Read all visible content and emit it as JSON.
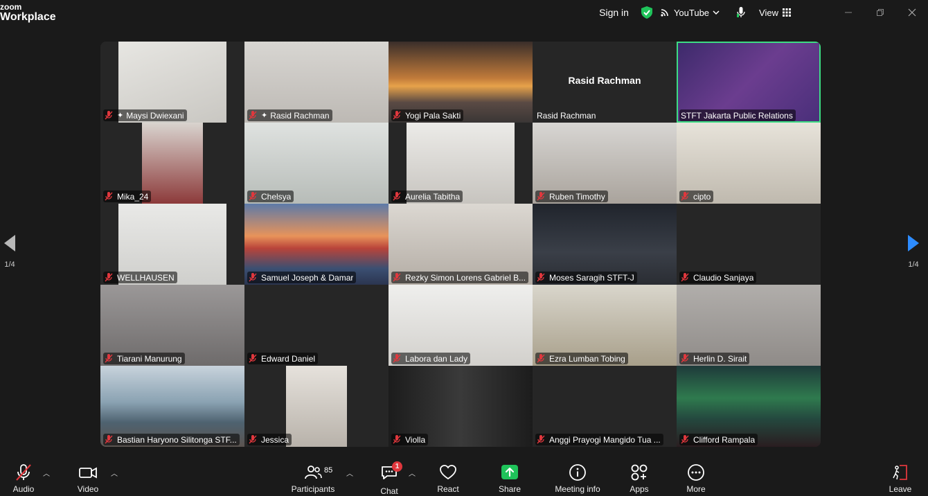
{
  "app": {
    "logo_line1": "zoom",
    "logo_line2": "Workplace"
  },
  "topbar": {
    "sign_in": "Sign in",
    "stream_label": "YouTube",
    "view_label": "View"
  },
  "pager": {
    "left": "1/4",
    "right": "1/4"
  },
  "colors": {
    "active_border": "#3ddc84",
    "mic_muted": "#e0373d",
    "share_green": "#1fc35a",
    "badge_red": "#e0373d"
  },
  "participants": [
    {
      "name": "Maysi Dwiexani",
      "pinned": true
    },
    {
      "name": "Rasid Rachman",
      "pinned": true
    },
    {
      "name": "Yogi Pala Sakti"
    },
    {
      "name": "Rasid Rachman",
      "video_off": true,
      "display_name": "Rasid Rachman"
    },
    {
      "name": "STFT Jakarta Public Relations",
      "active": true
    },
    {
      "name": "Mika_24"
    },
    {
      "name": "Chelsya"
    },
    {
      "name": "Aurelia Tabitha"
    },
    {
      "name": "Ruben Timothy"
    },
    {
      "name": "cipto"
    },
    {
      "name": "WELLHAUSEN"
    },
    {
      "name": "Samuel Joseph & Damar"
    },
    {
      "name": "Rezky Simon Lorens Gabriel B..."
    },
    {
      "name": "Moses Saragih STFT-J"
    },
    {
      "name": "Claudio Sanjaya"
    },
    {
      "name": "Tiarani Manurung"
    },
    {
      "name": "Edward Daniel"
    },
    {
      "name": "Labora dan Lady"
    },
    {
      "name": "Ezra Lumban Tobing"
    },
    {
      "name": "Herlin D. Sirait"
    },
    {
      "name": "Bastian Haryono Silitonga STF..."
    },
    {
      "name": "Jessica"
    },
    {
      "name": "Violla"
    },
    {
      "name": "Anggi Prayogi Mangido Tua ..."
    },
    {
      "name": "Clifford Rampala"
    }
  ],
  "toolbar": {
    "audio": "Audio",
    "video": "Video",
    "participants": "Participants",
    "participants_count": "85",
    "chat": "Chat",
    "chat_badge": "1",
    "react": "React",
    "share": "Share",
    "meeting_info": "Meeting info",
    "apps": "Apps",
    "more": "More",
    "leave": "Leave"
  }
}
